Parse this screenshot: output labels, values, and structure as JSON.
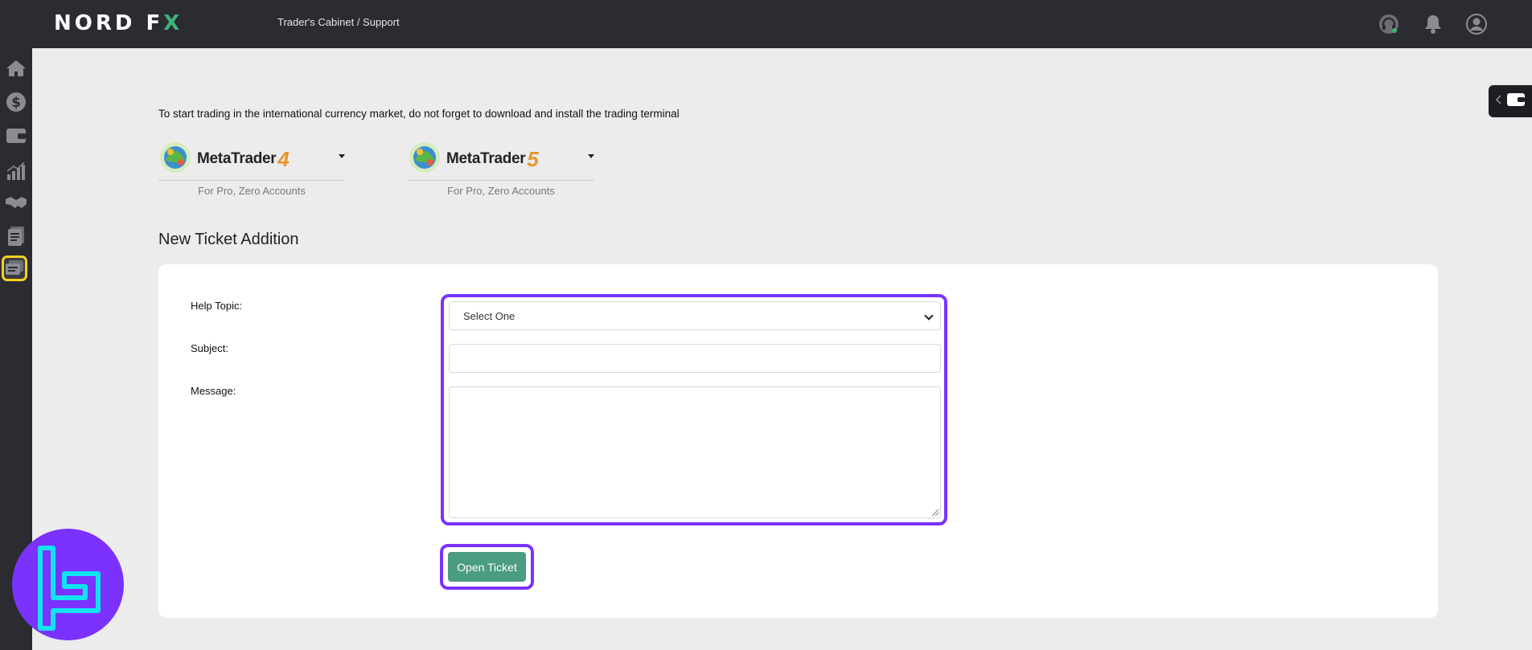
{
  "header": {
    "logo_main": "NORD F",
    "logo_accent": "X",
    "breadcrumb": "Trader's Cabinet / Support",
    "icons": [
      "headset-icon",
      "bell-icon",
      "user-icon"
    ]
  },
  "sidebar": {
    "items": [
      {
        "icon": "home-icon"
      },
      {
        "icon": "dollar-icon"
      },
      {
        "icon": "wallet-icon"
      },
      {
        "icon": "chart-icon"
      },
      {
        "icon": "handshake-icon"
      },
      {
        "icon": "document-icon"
      },
      {
        "icon": "support-ticket-icon",
        "active": true
      }
    ]
  },
  "intro_text": "To start trading in the international currency market, do not forget to download and install the trading terminal",
  "terminals": [
    {
      "name": "MetaTrader",
      "version": "4",
      "subtitle": "For Pro, Zero Accounts"
    },
    {
      "name": "MetaTrader",
      "version": "5",
      "subtitle": "For Pro, Zero Accounts"
    }
  ],
  "form": {
    "title": "New Ticket Addition",
    "help_topic_label": "Help Topic:",
    "subject_label": "Subject:",
    "message_label": "Message:",
    "help_topic_value": "Select One",
    "subject_value": "",
    "message_value": "",
    "submit_label": "Open Ticket"
  },
  "colors": {
    "topbar": "#2b2c31",
    "accent_green": "#3db37d",
    "button": "#4a9d7f",
    "highlight": "#7b32ff",
    "active_sidebar_border": "#f2d21b"
  }
}
